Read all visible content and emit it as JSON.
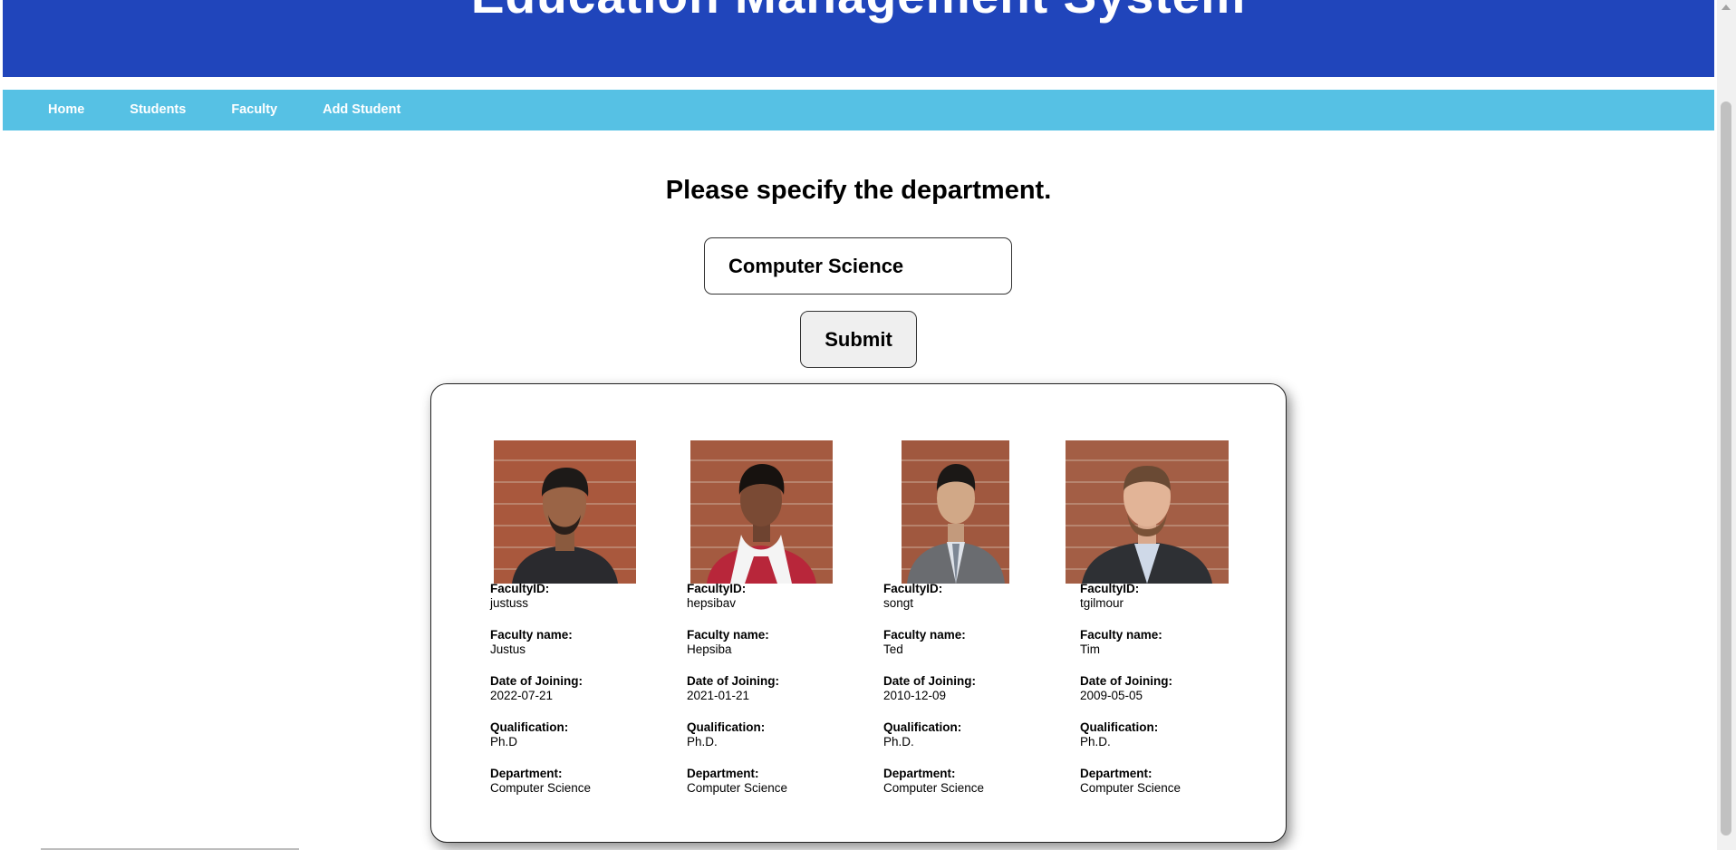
{
  "header": {
    "title": "Education Management System"
  },
  "nav": [
    {
      "label": "Home"
    },
    {
      "label": "Students"
    },
    {
      "label": "Faculty"
    },
    {
      "label": "Add Student"
    }
  ],
  "form": {
    "prompt": "Please specify the department.",
    "department_value": "Computer Science",
    "submit_label": "Submit"
  },
  "labels": {
    "id": "FacultyID:",
    "name": "Faculty name:",
    "joining": "Date of Joining:",
    "qualification": "Qualification:",
    "department": "Department:"
  },
  "faculty": [
    {
      "id": "justuss",
      "name": "Justus",
      "joining": "2022-07-21",
      "qualification": "Ph.D",
      "department": "Computer Science"
    },
    {
      "id": "hepsibav",
      "name": "Hepsiba",
      "joining": "2021-01-21",
      "qualification": "Ph.D.",
      "department": "Computer Science"
    },
    {
      "id": "songt",
      "name": "Ted",
      "joining": "2010-12-09",
      "qualification": "Ph.D.",
      "department": "Computer Science"
    },
    {
      "id": "tgilmour",
      "name": "Tim",
      "joining": "2009-05-05",
      "qualification": "Ph.D.",
      "department": "Computer Science"
    }
  ],
  "colors": {
    "header_bg": "#2045bb",
    "nav_bg": "#56c1e4",
    "brick": "#a8583c"
  }
}
